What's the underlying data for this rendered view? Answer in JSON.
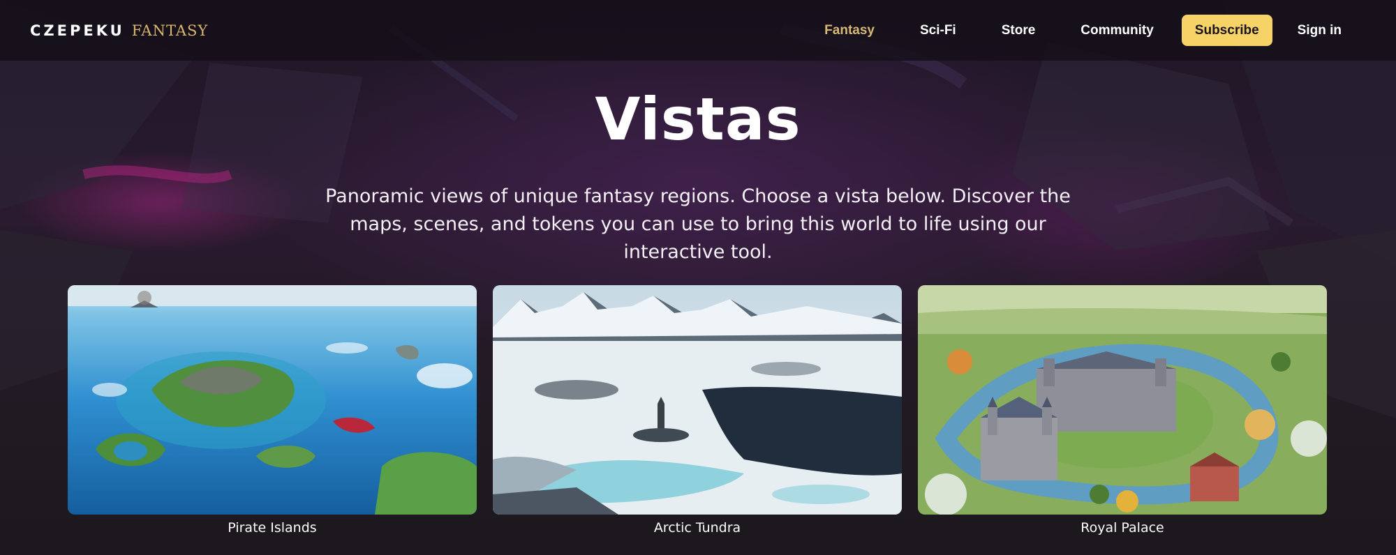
{
  "brand": {
    "main": "CZEPEKU",
    "sub": "FANTASY"
  },
  "nav": {
    "items": [
      {
        "label": "Fantasy",
        "active": true
      },
      {
        "label": "Sci-Fi"
      },
      {
        "label": "Store"
      },
      {
        "label": "Community"
      }
    ],
    "subscribe_label": "Subscribe",
    "signin_label": "Sign in"
  },
  "hero": {
    "title": "Vistas",
    "description": "Panoramic views of unique fantasy regions. Choose a vista below. Discover the maps, scenes, and tokens you can use to bring this world to life using our interactive tool."
  },
  "vistas": [
    {
      "label": "Pirate Islands"
    },
    {
      "label": "Arctic Tundra"
    },
    {
      "label": "Royal Palace"
    }
  ],
  "colors": {
    "accent_gold": "#d7b876",
    "subscribe_bg": "#f6d267",
    "header_bg": "#16101a"
  }
}
